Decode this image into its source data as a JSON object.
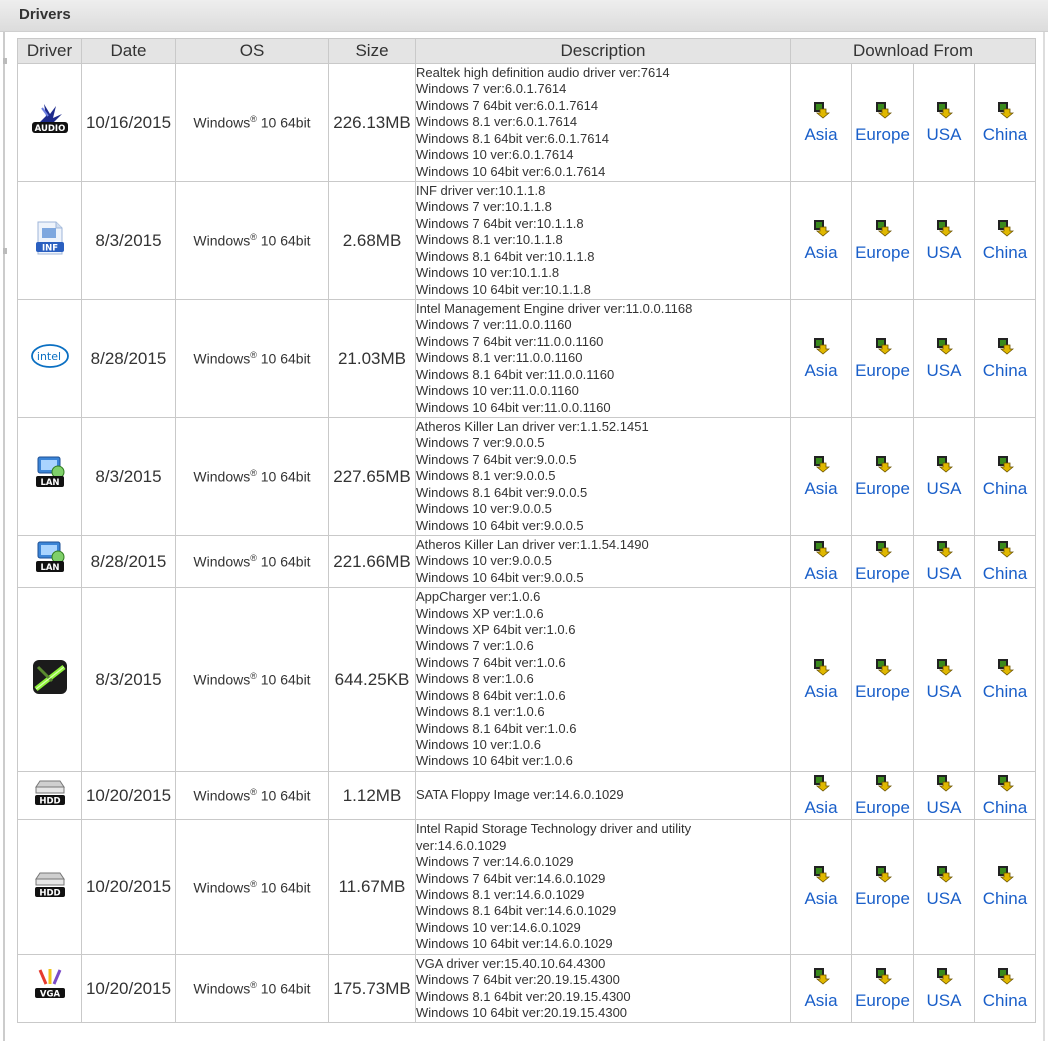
{
  "panel": {
    "title": "Drivers"
  },
  "table": {
    "headers": {
      "driver": "Driver",
      "date": "Date",
      "os": "OS",
      "size": "Size",
      "description": "Description",
      "download_from": "Download From"
    },
    "os_brand": "Windows",
    "os_mark": "®",
    "os_suffix": " 10 64bit",
    "download_labels": [
      "Asia",
      "Europe",
      "USA",
      "China"
    ],
    "rows": [
      {
        "icon": "audio-driver-icon",
        "date": "10/16/2015",
        "size": "226.13MB",
        "description": [
          "Realtek high definition audio driver ver:7614",
          "Windows 7 ver:6.0.1.7614",
          "Windows 7 64bit ver:6.0.1.7614",
          "Windows 8.1 ver:6.0.1.7614",
          "Windows 8.1 64bit ver:6.0.1.7614",
          "Windows 10 ver:6.0.1.7614",
          "Windows 10 64bit ver:6.0.1.7614"
        ]
      },
      {
        "icon": "inf-driver-icon",
        "date": "8/3/2015",
        "size": "2.68MB",
        "description": [
          "INF driver ver:10.1.1.8",
          "Windows 7 ver:10.1.1.8",
          "Windows 7 64bit ver:10.1.1.8",
          "Windows 8.1 ver:10.1.1.8",
          "Windows 8.1 64bit ver:10.1.1.8",
          "Windows 10 ver:10.1.1.8",
          "Windows 10 64bit ver:10.1.1.8"
        ]
      },
      {
        "icon": "intel-logo-icon",
        "date": "8/28/2015",
        "size": "21.03MB",
        "description": [
          "Intel Management Engine driver ver:11.0.0.1168",
          "Windows 7 ver:11.0.0.1160",
          "Windows 7 64bit ver:11.0.0.1160",
          "Windows 8.1 ver:11.0.0.1160",
          "Windows 8.1 64bit ver:11.0.0.1160",
          "Windows 10 ver:11.0.0.1160",
          "Windows 10 64bit ver:11.0.0.1160"
        ]
      },
      {
        "icon": "lan-driver-icon",
        "date": "8/3/2015",
        "size": "227.65MB",
        "description": [
          "Atheros Killer Lan driver ver:1.1.52.1451",
          "Windows 7 ver:9.0.0.5",
          "Windows 7 64bit ver:9.0.0.5",
          "Windows 8.1 ver:9.0.0.5",
          "Windows 8.1 64bit ver:9.0.0.5",
          "Windows 10 ver:9.0.0.5",
          "Windows 10 64bit ver:9.0.0.5"
        ]
      },
      {
        "icon": "lan-driver-icon",
        "date": "8/28/2015",
        "size": "221.66MB",
        "description": [
          "Atheros Killer Lan driver ver:1.1.54.1490",
          "Windows 10 ver:9.0.0.5",
          "Windows 10 64bit ver:9.0.0.5"
        ]
      },
      {
        "icon": "appcharger-icon",
        "date": "8/3/2015",
        "size": "644.25KB",
        "description": [
          "AppCharger ver:1.0.6",
          "Windows XP ver:1.0.6",
          "Windows XP 64bit ver:1.0.6",
          "Windows 7 ver:1.0.6",
          "Windows 7 64bit ver:1.0.6",
          "Windows 8 ver:1.0.6",
          "Windows 8 64bit ver:1.0.6",
          "Windows 8.1 ver:1.0.6",
          "Windows 8.1 64bit ver:1.0.6",
          "Windows 10 ver:1.0.6",
          "Windows 10 64bit ver:1.0.6"
        ]
      },
      {
        "icon": "hdd-driver-icon",
        "date": "10/20/2015",
        "size": "1.12MB",
        "description": [
          "SATA Floppy Image ver:14.6.0.1029"
        ]
      },
      {
        "icon": "hdd-driver-icon",
        "date": "10/20/2015",
        "size": "11.67MB",
        "description": [
          "Intel Rapid Storage Technology driver and utility",
          "ver:14.6.0.1029",
          "Windows 7 ver:14.6.0.1029",
          "Windows 7 64bit ver:14.6.0.1029",
          "Windows 8.1 ver:14.6.0.1029",
          "Windows 8.1 64bit ver:14.6.0.1029",
          "Windows 10 ver:14.6.0.1029",
          "Windows 10 64bit ver:14.6.0.1029"
        ]
      },
      {
        "icon": "vga-driver-icon",
        "date": "10/20/2015",
        "size": "175.73MB",
        "description": [
          "VGA driver ver:15.40.10.64.4300",
          "Windows 7 64bit ver:20.19.15.4300",
          "Windows 8.1 64bit ver:20.19.15.4300",
          "Windows 10 64bit ver:20.19.15.4300"
        ]
      }
    ]
  },
  "colors": {
    "link": "#1a5fc9",
    "header_bg": "#e4e4e4",
    "border": "#c9c9c9",
    "download_icon_green": "#3a8a1c",
    "download_icon_yellow": "#e0b800"
  }
}
